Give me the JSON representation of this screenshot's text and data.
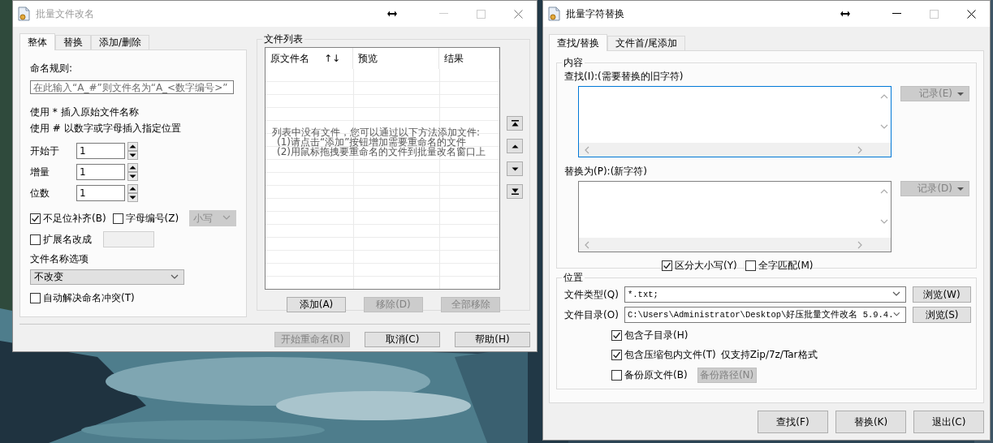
{
  "rename_window": {
    "title": "批量文件改名",
    "active": false,
    "tabs": [
      {
        "label": "整体",
        "selected": true
      },
      {
        "label": "替换",
        "selected": false
      },
      {
        "label": "添加/删除",
        "selected": false
      }
    ],
    "rule_label": "命名规则:",
    "rule_field": {
      "placeholder": "在此输入“A_#”则文件名为“A_<数字编号>”"
    },
    "hints": [
      "使用 * 插入原始文件名称",
      "使用 # 以数字或字母插入指定位置"
    ],
    "spinners": [
      {
        "label": "开始于",
        "value": "1"
      },
      {
        "label": "增量",
        "value": "1"
      },
      {
        "label": "位数",
        "value": "1"
      }
    ],
    "pad_option": {
      "label": "不足位补齐(B)",
      "checked": true
    },
    "letter_option": {
      "label": "字母编号(Z)",
      "checked": false
    },
    "case_select": {
      "value": "小写",
      "disabled": true
    },
    "extension_option": {
      "label": "扩展名改成",
      "checked": false
    },
    "extension_field": {
      "disabled": true
    },
    "name_option_label": "文件名称选项",
    "name_option_select": {
      "value": "不改变",
      "disabled": false
    },
    "conflict_option": {
      "label": "自动解决命名冲突(T)",
      "checked": false
    },
    "file_list": {
      "title": "文件列表",
      "columns": [
        "原文件名",
        "预览",
        "结果"
      ],
      "sort_mark": "↑↓",
      "empty_message": [
        "列表中没有文件，您可以通过以下方法添加文件:",
        "(1)请点击“添加”按钮增加需要重命名的文件",
        "(2)用鼠标拖拽要重命名的文件到批量改名窗口上"
      ],
      "buttons": [
        {
          "label": "添加(A)",
          "disabled": false
        },
        {
          "label": "移除(D)",
          "disabled": true
        },
        {
          "label": "全部移除",
          "disabled": true
        }
      ]
    },
    "footer_buttons": [
      {
        "label": "开始重命名(R)",
        "disabled": true
      },
      {
        "label": "取消(C)",
        "disabled": false
      },
      {
        "label": "帮助(H)",
        "disabled": false
      }
    ]
  },
  "replace_window": {
    "title": "批量字符替换",
    "active": true,
    "tabs": [
      {
        "label": "查找/替换",
        "selected": true
      },
      {
        "label": "文件首/尾添加",
        "selected": false
      }
    ],
    "content_group": {
      "title": "内容",
      "find_label": "查找(I):(需要替换的旧字符)",
      "find_field": {
        "focused": true
      },
      "find_history": {
        "label": "记录(E)",
        "disabled": true
      },
      "replace_label": "替换为(P):(新字符)",
      "replace_field": {
        "focused": false
      },
      "replace_history": {
        "label": "记录(D)",
        "disabled": true
      },
      "options": [
        {
          "label": "区分大小写(Y)",
          "checked": true
        },
        {
          "label": "全字匹配(M)",
          "checked": false
        }
      ]
    },
    "location_group": {
      "title": "位置",
      "rows": [
        {
          "label": "文件类型(Q)",
          "value": "*.txt;",
          "button": "浏览(W)"
        },
        {
          "label": "文件目录(O)",
          "value": "C:\\Users\\Administrator\\Desktop\\好压批量文件改名 5.9.4.",
          "button": "浏览(S)"
        }
      ],
      "options": [
        {
          "label": "包含子目录(H)",
          "checked": true
        },
        {
          "label": "包含压缩包内文件(T)",
          "checked": true,
          "note": "仅支持Zip/7z/Tar格式"
        },
        {
          "label": "备份原文件(B)",
          "checked": false,
          "button": {
            "label": "备份路径(N)",
            "disabled": true
          }
        }
      ]
    },
    "footer_buttons": [
      {
        "label": "查找(F)",
        "disabled": false
      },
      {
        "label": "替换(K)",
        "disabled": false
      },
      {
        "label": "退出(C)",
        "disabled": false
      }
    ]
  }
}
